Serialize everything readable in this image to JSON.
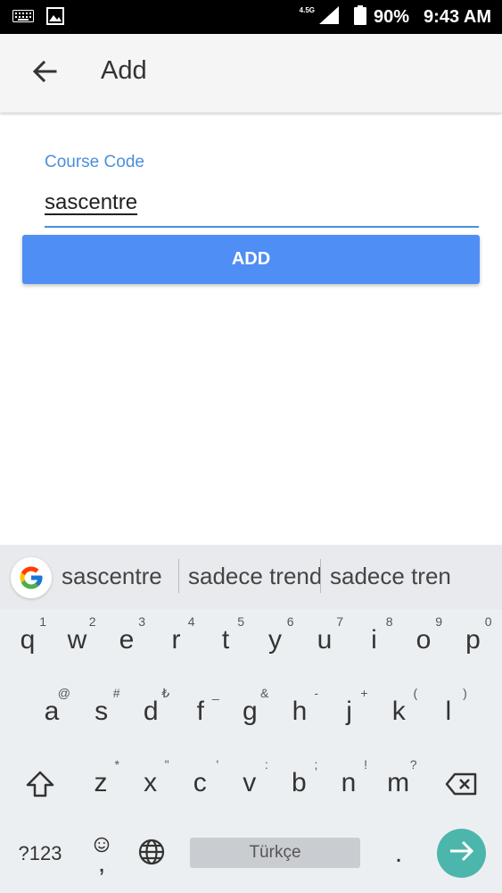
{
  "status_bar": {
    "left_icons": [
      "keyboard-icon",
      "image-icon"
    ],
    "network": "4.5G",
    "battery": "90%",
    "time": "9:43 AM"
  },
  "app_bar": {
    "title": "Add",
    "back_icon": "arrow-back-icon"
  },
  "form": {
    "label": "Course Code",
    "value": "sascentre",
    "button": "ADD"
  },
  "keyboard": {
    "suggestions": [
      "sascentre",
      "sadece trend",
      "sadece tren"
    ],
    "row1": [
      {
        "key": "q",
        "sup": "1"
      },
      {
        "key": "w",
        "sup": "2"
      },
      {
        "key": "e",
        "sup": "3"
      },
      {
        "key": "r",
        "sup": "4"
      },
      {
        "key": "t",
        "sup": "5"
      },
      {
        "key": "y",
        "sup": "6"
      },
      {
        "key": "u",
        "sup": "7"
      },
      {
        "key": "i",
        "sup": "8"
      },
      {
        "key": "o",
        "sup": "9"
      },
      {
        "key": "p",
        "sup": "0"
      }
    ],
    "row2": [
      {
        "key": "a",
        "sup": "@"
      },
      {
        "key": "s",
        "sup": "#"
      },
      {
        "key": "d",
        "sup": "₺"
      },
      {
        "key": "f",
        "sup": "_"
      },
      {
        "key": "g",
        "sup": "&"
      },
      {
        "key": "h",
        "sup": "-"
      },
      {
        "key": "j",
        "sup": "+"
      },
      {
        "key": "k",
        "sup": "("
      },
      {
        "key": "l",
        "sup": ")"
      }
    ],
    "row3": [
      {
        "key": "z",
        "sup": "*"
      },
      {
        "key": "x",
        "sup": "\""
      },
      {
        "key": "c",
        "sup": "'"
      },
      {
        "key": "v",
        "sup": ":"
      },
      {
        "key": "b",
        "sup": ";"
      },
      {
        "key": "n",
        "sup": "!"
      },
      {
        "key": "m",
        "sup": "?"
      }
    ],
    "symbols_label": "?123",
    "comma": ",",
    "space_label": "Türkçe",
    "period": "."
  }
}
